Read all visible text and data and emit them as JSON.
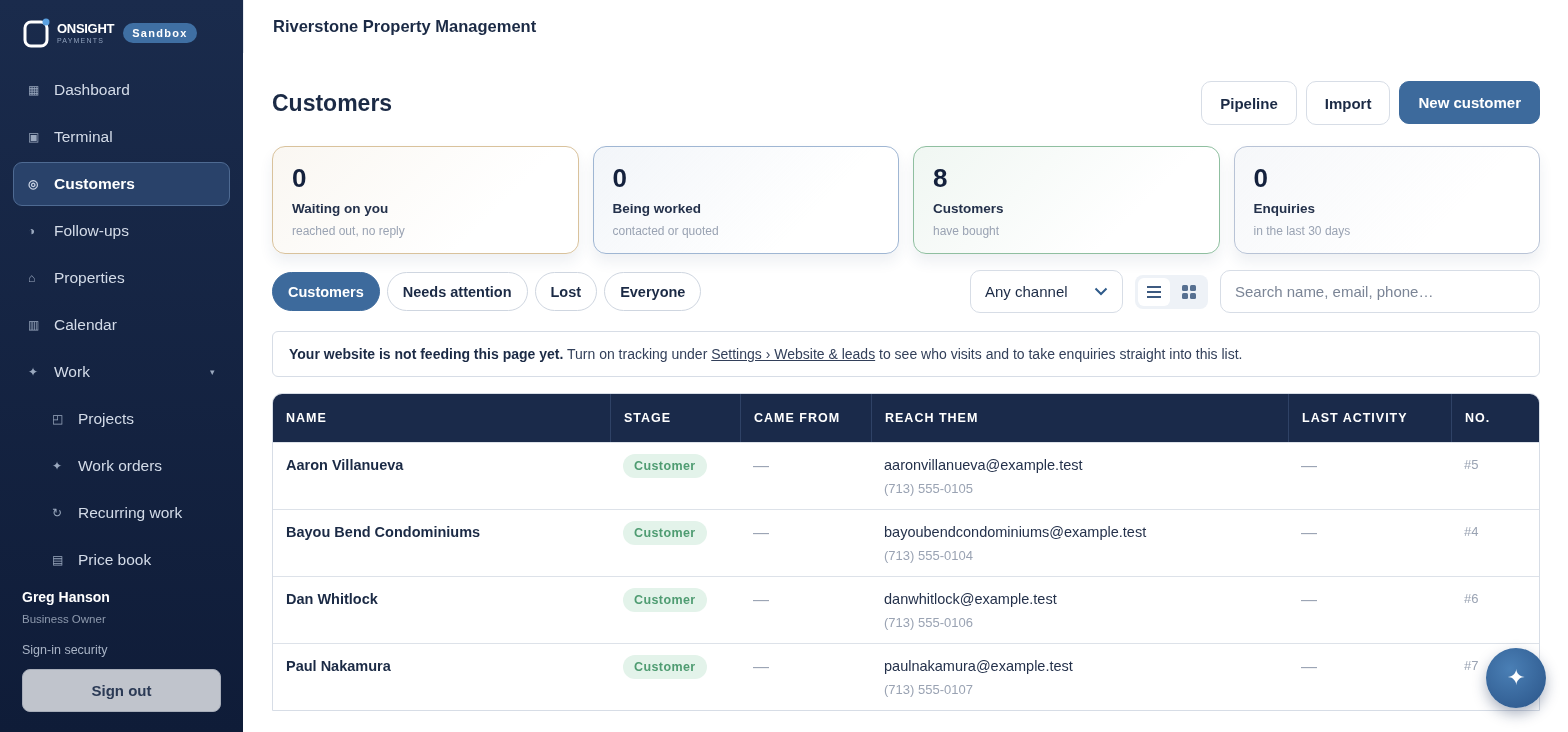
{
  "brand": {
    "name": "ONSIGHT",
    "tagline": "PAYMENTS",
    "badge": "Sandbox"
  },
  "sidebar": {
    "items": [
      {
        "icon": "▦",
        "label": "Dashboard",
        "selected": false
      },
      {
        "icon": "▣",
        "label": "Terminal",
        "selected": false
      },
      {
        "icon": "◎",
        "label": "Customers",
        "selected": true
      },
      {
        "icon": "◑",
        "label": "Follow-ups",
        "selected": false
      },
      {
        "icon": "⌂",
        "label": "Properties",
        "selected": false
      },
      {
        "icon": "▥",
        "label": "Calendar",
        "selected": false
      },
      {
        "icon": "✦",
        "label": "Work",
        "selected": false,
        "expanded": true,
        "toggle": "▾",
        "children": [
          {
            "icon": "◰",
            "label": "Projects",
            "selected": false
          },
          {
            "icon": "✦",
            "label": "Work orders",
            "selected": false
          },
          {
            "icon": "↻",
            "label": "Recurring work",
            "selected": false
          },
          {
            "icon": "▤",
            "label": "Price book",
            "selected": false
          }
        ]
      }
    ],
    "user": {
      "name": "Greg Hanson",
      "role": "Business Owner"
    },
    "security_link": "Sign-in security",
    "sign_out": "Sign out"
  },
  "topbar": {
    "title": "Riverstone Property Management"
  },
  "page": {
    "title": "Customers",
    "actions": [
      {
        "label": "Pipeline",
        "kind": "secondary"
      },
      {
        "label": "Import",
        "kind": "secondary"
      },
      {
        "label": "New customer",
        "kind": "primary"
      }
    ]
  },
  "stats": [
    {
      "value": "0",
      "label": "Waiting on you",
      "sub": "reached out, no reply",
      "color": "#d9c29c"
    },
    {
      "value": "0",
      "label": "Being worked",
      "sub": "contacted or quoted",
      "color": "#9fb6d3"
    },
    {
      "value": "8",
      "label": "Customers",
      "sub": "have bought",
      "color": "#8fbfa0"
    },
    {
      "value": "0",
      "label": "Enquiries",
      "sub": "in the last 30 days",
      "color": "#b8c3d6"
    }
  ],
  "filters": [
    {
      "label": "Customers",
      "selected": true
    },
    {
      "label": "Needs attention",
      "selected": false
    },
    {
      "label": "Lost",
      "selected": false
    },
    {
      "label": "Everyone",
      "selected": false
    }
  ],
  "channel_select": {
    "value": "Any channel"
  },
  "views": [
    {
      "kind": "list",
      "selected": true
    },
    {
      "kind": "grid",
      "selected": false
    }
  ],
  "search": {
    "placeholder": "Search name, email, phone…"
  },
  "notice": {
    "text": "**Your website is not feeding this page yet.** Turn on tracking under",
    "link": "Settings › Website & leads",
    "text_after": "to see who visits and to take enquiries straight into this list."
  },
  "table": {
    "columns": [
      "NAME",
      "STAGE",
      "CAME FROM",
      "REACH THEM",
      "LAST ACTIVITY",
      "NO."
    ],
    "rows": [
      {
        "name": "Aaron Villanueva",
        "stage": "Customer",
        "came_from": "—",
        "email": "aaronvillanueva@example.test",
        "phone": "(713) 555-0105",
        "last_activity": "—",
        "no": "#5"
      },
      {
        "name": "Bayou Bend Condominiums",
        "stage": "Customer",
        "came_from": "—",
        "email": "bayoubendcondominiums@example.test",
        "phone": "(713) 555-0104",
        "last_activity": "—",
        "no": "#4"
      },
      {
        "name": "Dan Whitlock",
        "stage": "Customer",
        "came_from": "—",
        "email": "danwhitlock@example.test",
        "phone": "(713) 555-0106",
        "last_activity": "—",
        "no": "#6"
      },
      {
        "name": "Paul Nakamura",
        "stage": "Customer",
        "came_from": "—",
        "email": "paulnakamura@example.test",
        "phone": "(713) 555-0107",
        "last_activity": "—",
        "no": "#7"
      }
    ]
  },
  "fab": {
    "icon": "✦"
  }
}
